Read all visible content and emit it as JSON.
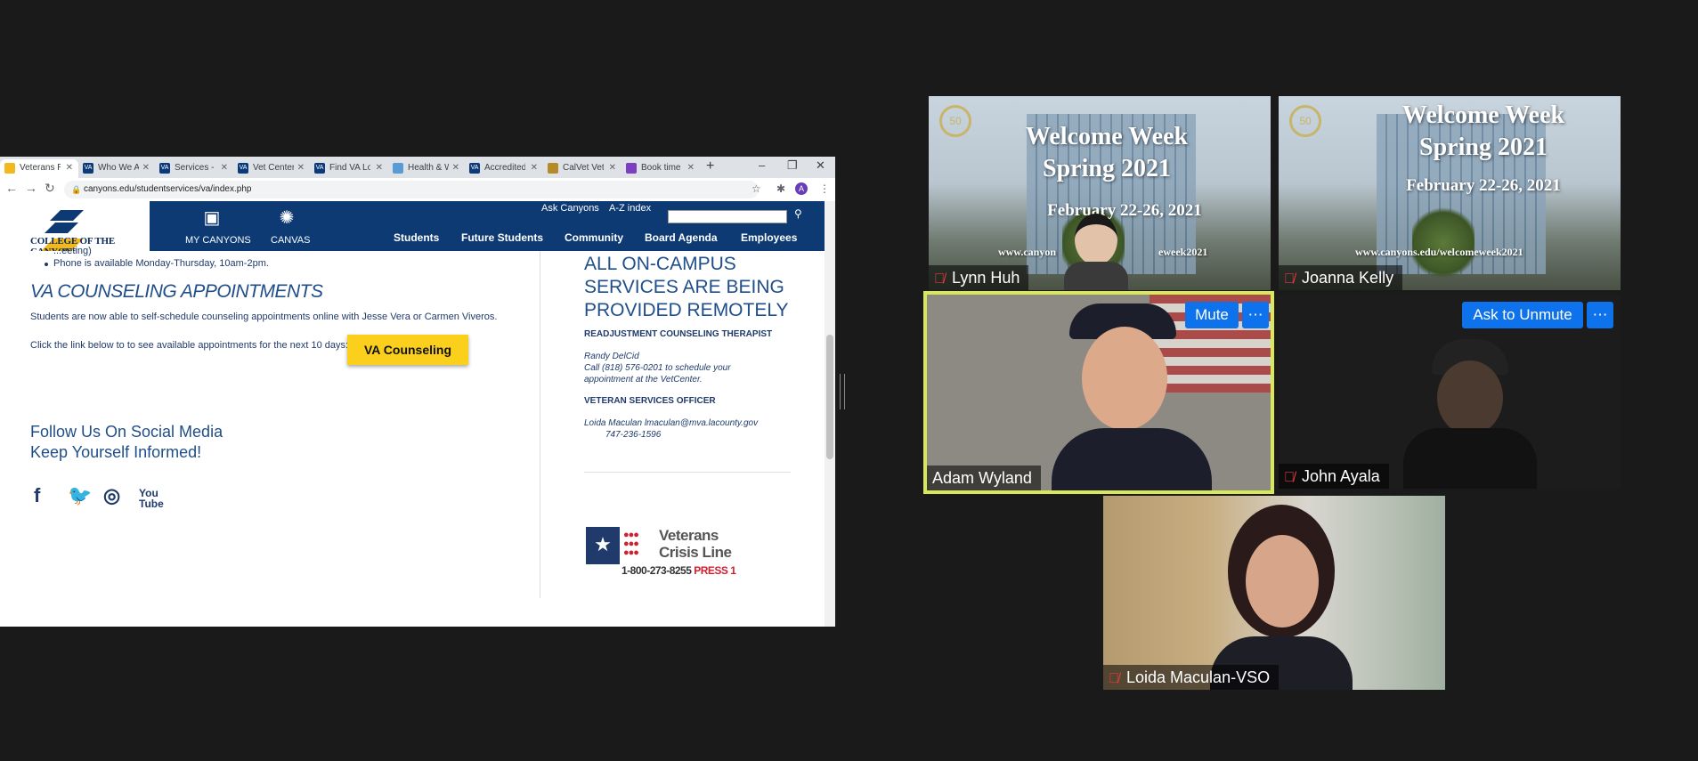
{
  "browser": {
    "tabs": [
      {
        "label": "Veterans Re",
        "favicon": "college-of-the-canyons-favicon",
        "active": true
      },
      {
        "label": "Who We Ar",
        "favicon": "va-favicon"
      },
      {
        "label": "Services - E",
        "favicon": "va-favicon"
      },
      {
        "label": "Vet Center",
        "favicon": "va-favicon"
      },
      {
        "label": "Find VA Lo",
        "favicon": "va-favicon"
      },
      {
        "label": "Health & W",
        "favicon": "health-favicon"
      },
      {
        "label": "Accredited",
        "favicon": "va-favicon"
      },
      {
        "label": "CalVet Vete",
        "favicon": "calvet-favicon"
      },
      {
        "label": "Book time",
        "favicon": "booking-favicon"
      }
    ],
    "url": "canyons.edu/studentservices/va/index.php"
  },
  "site": {
    "logo_text": "COLLEGE OF THE CANYONS",
    "top_links": {
      "ask": "Ask Canyons",
      "az": "A-Z index"
    },
    "quick": {
      "my_canyons": "MY CANYONS",
      "canvas": "CANVAS"
    },
    "nav": [
      "Students",
      "Future Students",
      "Community",
      "Board Agenda",
      "Employees"
    ]
  },
  "content": {
    "partial_top": "...eeting)",
    "phone_line": "Phone is available Monday-Thursday, 10am-2pm.",
    "va_heading": "VA COUNSELING APPOINTMENTS",
    "va_para1": "Students are now able to self-schedule counseling appointments online with Jesse Vera or Carmen Viveros.",
    "va_para2": "Click the link below to to see available appointments for the next 10 days:",
    "va_button": "VA Counseling",
    "follow1": "Follow Us On Social Media",
    "follow2": "Keep Yourself Informed!",
    "right_heading": "ALL ON-CAMPUS SERVICES ARE BEING PROVIDED REMOTELY",
    "readjust_title": "READJUSTMENT COUNSELING THERAPIST",
    "readjust_name": "Randy DelCid",
    "readjust_call": "Call (818) 576-0201 to schedule your",
    "readjust_call2": "appointment at the VetCenter.",
    "officer_title": "VETERAN SERVICES OFFICER",
    "officer_line": "Loida Maculan lmaculan@mva.lacounty.gov",
    "officer_phone": "747-236-1596",
    "crisis_name1": "Veterans",
    "crisis_name2": "Crisis Line",
    "crisis_phone": "1-800-273-8255",
    "crisis_press": "PRESS 1"
  },
  "meeting": {
    "participants": [
      {
        "name": "Lynn Huh",
        "muted": true
      },
      {
        "name": "Joanna Kelly",
        "muted": true
      },
      {
        "name": "Adam Wyland",
        "muted": false,
        "speaking": true
      },
      {
        "name": "John Ayala",
        "muted": true
      },
      {
        "name": "Loida Maculan-VSO",
        "muted": true
      }
    ],
    "welcome": {
      "line1": "Welcome Week",
      "line2": "Spring 2021",
      "dates": "February 22-26, 2021",
      "url": "www.canyons.edu/welcomeweek2021",
      "dates_partial": "February 22-26, 2021",
      "url_partial_left": "www.canyon",
      "url_partial_right": "eweek2021"
    },
    "buttons": {
      "mute": "Mute",
      "ask_unmute": "Ask to Unmute",
      "more": "⋯"
    }
  },
  "colors": {
    "accent": "#0e72ed",
    "speaker_border": "#d9e85a",
    "site_navy": "#0d3a73",
    "button_yellow": "#fbd01c"
  }
}
